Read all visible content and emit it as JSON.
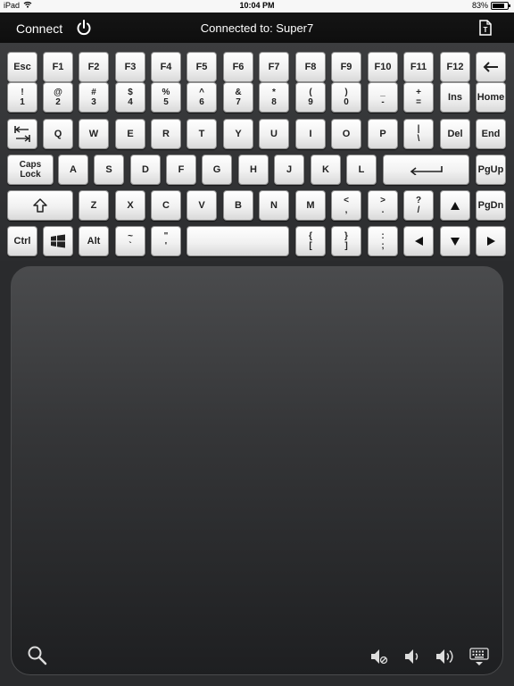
{
  "status_bar": {
    "device": "iPad",
    "time": "10:04 PM",
    "battery": "83%",
    "battery_level": 0.83
  },
  "top_bar": {
    "connect_label": "Connect",
    "connection_status": "Connected to: Super7"
  },
  "keyboard": {
    "row1": [
      "Esc",
      "F1",
      "F2",
      "F3",
      "F4",
      "F5",
      "F6",
      "F7",
      "F8",
      "F9",
      "F10",
      "F11",
      "F12"
    ],
    "row2": [
      [
        "!",
        "1"
      ],
      [
        "@",
        "2"
      ],
      [
        "#",
        "3"
      ],
      [
        "$",
        "4"
      ],
      [
        "%",
        "5"
      ],
      [
        "^",
        "6"
      ],
      [
        "&",
        "7"
      ],
      [
        "*",
        "8"
      ],
      [
        "(",
        "9"
      ],
      [
        ")",
        "0"
      ],
      [
        "_",
        "-"
      ],
      [
        "+",
        "="
      ]
    ],
    "row2_extra": [
      "Ins",
      "Home"
    ],
    "row3": [
      "Q",
      "W",
      "E",
      "R",
      "T",
      "Y",
      "U",
      "I",
      "O",
      "P"
    ],
    "row3_pipe": [
      "|",
      "\\"
    ],
    "row3_extra": [
      "Del",
      "End"
    ],
    "caps": [
      "Caps",
      "Lock"
    ],
    "row4": [
      "A",
      "S",
      "D",
      "F",
      "G",
      "H",
      "J",
      "K",
      "L"
    ],
    "row4_extra": "PgUp",
    "row5": [
      "Z",
      "X",
      "C",
      "V",
      "B",
      "N",
      "M"
    ],
    "row5_punct": [
      [
        "<",
        ","
      ],
      [
        ">",
        "."
      ],
      [
        "?",
        "/"
      ]
    ],
    "row5_extra": "PgDn",
    "row6_ctrl": "Ctrl",
    "row6_alt": "Alt",
    "row6_punct1": [
      [
        "~",
        "`"
      ],
      [
        "\"",
        "'"
      ]
    ],
    "row6_punct2": [
      [
        "{",
        "["
      ],
      [
        "}",
        "]"
      ],
      [
        ":",
        ";"
      ]
    ]
  },
  "icons": {
    "power": "power-icon",
    "document": "document-icon",
    "backspace": "backspace-arrow-icon",
    "tab": "tab-icon",
    "enter": "enter-arrow-icon",
    "shift": "shift-arrow-icon",
    "windows": "windows-logo-icon",
    "search": "search-icon",
    "mute": "volume-mute-icon",
    "vol_down": "volume-down-icon",
    "vol_up": "volume-up-icon",
    "hide_keyboard": "hide-keyboard-icon"
  },
  "colors": {
    "top_bar": "#111111",
    "key_face": "#f1f1f1",
    "key_text": "#222222",
    "touchpad_top": "#4a4b4d",
    "touchpad_bottom": "#1e1f21"
  }
}
